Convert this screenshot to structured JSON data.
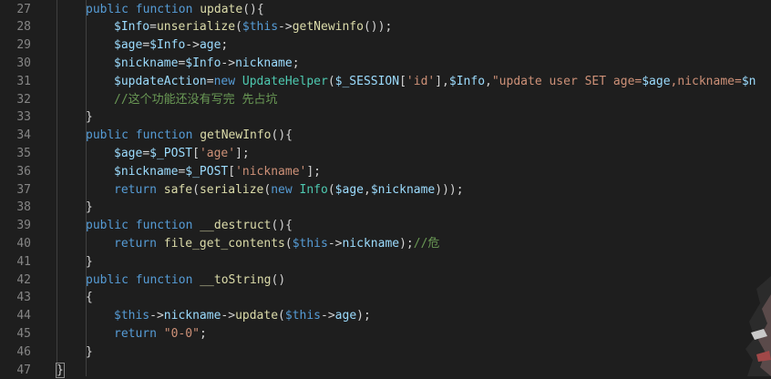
{
  "editor": {
    "lines": [
      {
        "num": "27",
        "indent": 1,
        "tokens": [
          {
            "c": "kw",
            "t": "public function "
          },
          {
            "c": "fn",
            "t": "update"
          },
          {
            "c": "plain",
            "t": "(){"
          }
        ]
      },
      {
        "num": "28",
        "indent": 2,
        "tokens": [
          {
            "c": "var",
            "t": "$Info"
          },
          {
            "c": "plain",
            "t": "="
          },
          {
            "c": "fn",
            "t": "unserialize"
          },
          {
            "c": "plain",
            "t": "("
          },
          {
            "c": "kw",
            "t": "$this"
          },
          {
            "c": "plain",
            "t": "->"
          },
          {
            "c": "fn",
            "t": "getNewinfo"
          },
          {
            "c": "plain",
            "t": "());"
          }
        ]
      },
      {
        "num": "29",
        "indent": 2,
        "tokens": [
          {
            "c": "var",
            "t": "$age"
          },
          {
            "c": "plain",
            "t": "="
          },
          {
            "c": "var",
            "t": "$Info"
          },
          {
            "c": "plain",
            "t": "->"
          },
          {
            "c": "var",
            "t": "age"
          },
          {
            "c": "plain",
            "t": ";"
          }
        ]
      },
      {
        "num": "30",
        "indent": 2,
        "tokens": [
          {
            "c": "var",
            "t": "$nickname"
          },
          {
            "c": "plain",
            "t": "="
          },
          {
            "c": "var",
            "t": "$Info"
          },
          {
            "c": "plain",
            "t": "->"
          },
          {
            "c": "var",
            "t": "nickname"
          },
          {
            "c": "plain",
            "t": ";"
          }
        ]
      },
      {
        "num": "31",
        "indent": 2,
        "tokens": [
          {
            "c": "var",
            "t": "$updateAction"
          },
          {
            "c": "plain",
            "t": "="
          },
          {
            "c": "kw",
            "t": "new "
          },
          {
            "c": "cls",
            "t": "UpdateHelper"
          },
          {
            "c": "plain",
            "t": "("
          },
          {
            "c": "var",
            "t": "$_SESSION"
          },
          {
            "c": "plain",
            "t": "["
          },
          {
            "c": "str",
            "t": "'id'"
          },
          {
            "c": "plain",
            "t": "],"
          },
          {
            "c": "var",
            "t": "$Info"
          },
          {
            "c": "plain",
            "t": ","
          },
          {
            "c": "str",
            "t": "\"update user SET age="
          },
          {
            "c": "var",
            "t": "$age"
          },
          {
            "c": "str",
            "t": ",nickname="
          },
          {
            "c": "var",
            "t": "$n"
          }
        ]
      },
      {
        "num": "32",
        "indent": 2,
        "tokens": [
          {
            "c": "cmt",
            "t": "//这个功能还没有写完 先占坑"
          }
        ]
      },
      {
        "num": "33",
        "indent": 1,
        "tokens": [
          {
            "c": "plain",
            "t": "}"
          }
        ]
      },
      {
        "num": "34",
        "indent": 1,
        "tokens": [
          {
            "c": "kw",
            "t": "public function "
          },
          {
            "c": "fn",
            "t": "getNewInfo"
          },
          {
            "c": "plain",
            "t": "(){"
          }
        ]
      },
      {
        "num": "35",
        "indent": 2,
        "tokens": [
          {
            "c": "var",
            "t": "$age"
          },
          {
            "c": "plain",
            "t": "="
          },
          {
            "c": "var",
            "t": "$_POST"
          },
          {
            "c": "plain",
            "t": "["
          },
          {
            "c": "str",
            "t": "'age'"
          },
          {
            "c": "plain",
            "t": "];"
          }
        ]
      },
      {
        "num": "36",
        "indent": 2,
        "tokens": [
          {
            "c": "var",
            "t": "$nickname"
          },
          {
            "c": "plain",
            "t": "="
          },
          {
            "c": "var",
            "t": "$_POST"
          },
          {
            "c": "plain",
            "t": "["
          },
          {
            "c": "str",
            "t": "'nickname'"
          },
          {
            "c": "plain",
            "t": "];"
          }
        ]
      },
      {
        "num": "37",
        "indent": 2,
        "tokens": [
          {
            "c": "kw",
            "t": "return "
          },
          {
            "c": "fn",
            "t": "safe"
          },
          {
            "c": "plain",
            "t": "("
          },
          {
            "c": "fn",
            "t": "serialize"
          },
          {
            "c": "plain",
            "t": "("
          },
          {
            "c": "kw",
            "t": "new "
          },
          {
            "c": "cls",
            "t": "Info"
          },
          {
            "c": "plain",
            "t": "("
          },
          {
            "c": "var",
            "t": "$age"
          },
          {
            "c": "plain",
            "t": ","
          },
          {
            "c": "var",
            "t": "$nickname"
          },
          {
            "c": "plain",
            "t": ")));"
          }
        ]
      },
      {
        "num": "38",
        "indent": 1,
        "tokens": [
          {
            "c": "plain",
            "t": "}"
          }
        ]
      },
      {
        "num": "39",
        "indent": 1,
        "tokens": [
          {
            "c": "kw",
            "t": "public function "
          },
          {
            "c": "fn",
            "t": "__destruct"
          },
          {
            "c": "plain",
            "t": "(){"
          }
        ]
      },
      {
        "num": "40",
        "indent": 2,
        "tokens": [
          {
            "c": "kw",
            "t": "return "
          },
          {
            "c": "fn",
            "t": "file_get_contents"
          },
          {
            "c": "plain",
            "t": "("
          },
          {
            "c": "kw",
            "t": "$this"
          },
          {
            "c": "plain",
            "t": "->"
          },
          {
            "c": "var",
            "t": "nickname"
          },
          {
            "c": "plain",
            "t": ");"
          },
          {
            "c": "cmt",
            "t": "//危"
          }
        ]
      },
      {
        "num": "41",
        "indent": 1,
        "tokens": [
          {
            "c": "plain",
            "t": "}"
          }
        ]
      },
      {
        "num": "42",
        "indent": 1,
        "tokens": [
          {
            "c": "kw",
            "t": "public function "
          },
          {
            "c": "fn",
            "t": "__toString"
          },
          {
            "c": "plain",
            "t": "()"
          }
        ]
      },
      {
        "num": "43",
        "indent": 1,
        "tokens": [
          {
            "c": "plain",
            "t": "{"
          }
        ]
      },
      {
        "num": "44",
        "indent": 2,
        "tokens": [
          {
            "c": "kw",
            "t": "$this"
          },
          {
            "c": "plain",
            "t": "->"
          },
          {
            "c": "var",
            "t": "nickname"
          },
          {
            "c": "plain",
            "t": "->"
          },
          {
            "c": "fn",
            "t": "update"
          },
          {
            "c": "plain",
            "t": "("
          },
          {
            "c": "kw",
            "t": "$this"
          },
          {
            "c": "plain",
            "t": "->"
          },
          {
            "c": "var",
            "t": "age"
          },
          {
            "c": "plain",
            "t": ");"
          }
        ]
      },
      {
        "num": "45",
        "indent": 2,
        "tokens": [
          {
            "c": "kw",
            "t": "return "
          },
          {
            "c": "str",
            "t": "\"0-0\""
          },
          {
            "c": "plain",
            "t": ";"
          }
        ]
      },
      {
        "num": "46",
        "indent": 1,
        "tokens": [
          {
            "c": "plain",
            "t": "}"
          }
        ]
      },
      {
        "num": "47",
        "indent": 0,
        "tokens": [
          {
            "c": "plain",
            "t": "}"
          }
        ]
      }
    ]
  },
  "colors": {
    "background": "#1e1e1e",
    "line_number": "#858585",
    "keyword": "#569cd6",
    "function": "#dcdcaa",
    "variable": "#9cdcfe",
    "string": "#ce9178",
    "comment": "#6a9955",
    "class": "#4ec9b0"
  }
}
